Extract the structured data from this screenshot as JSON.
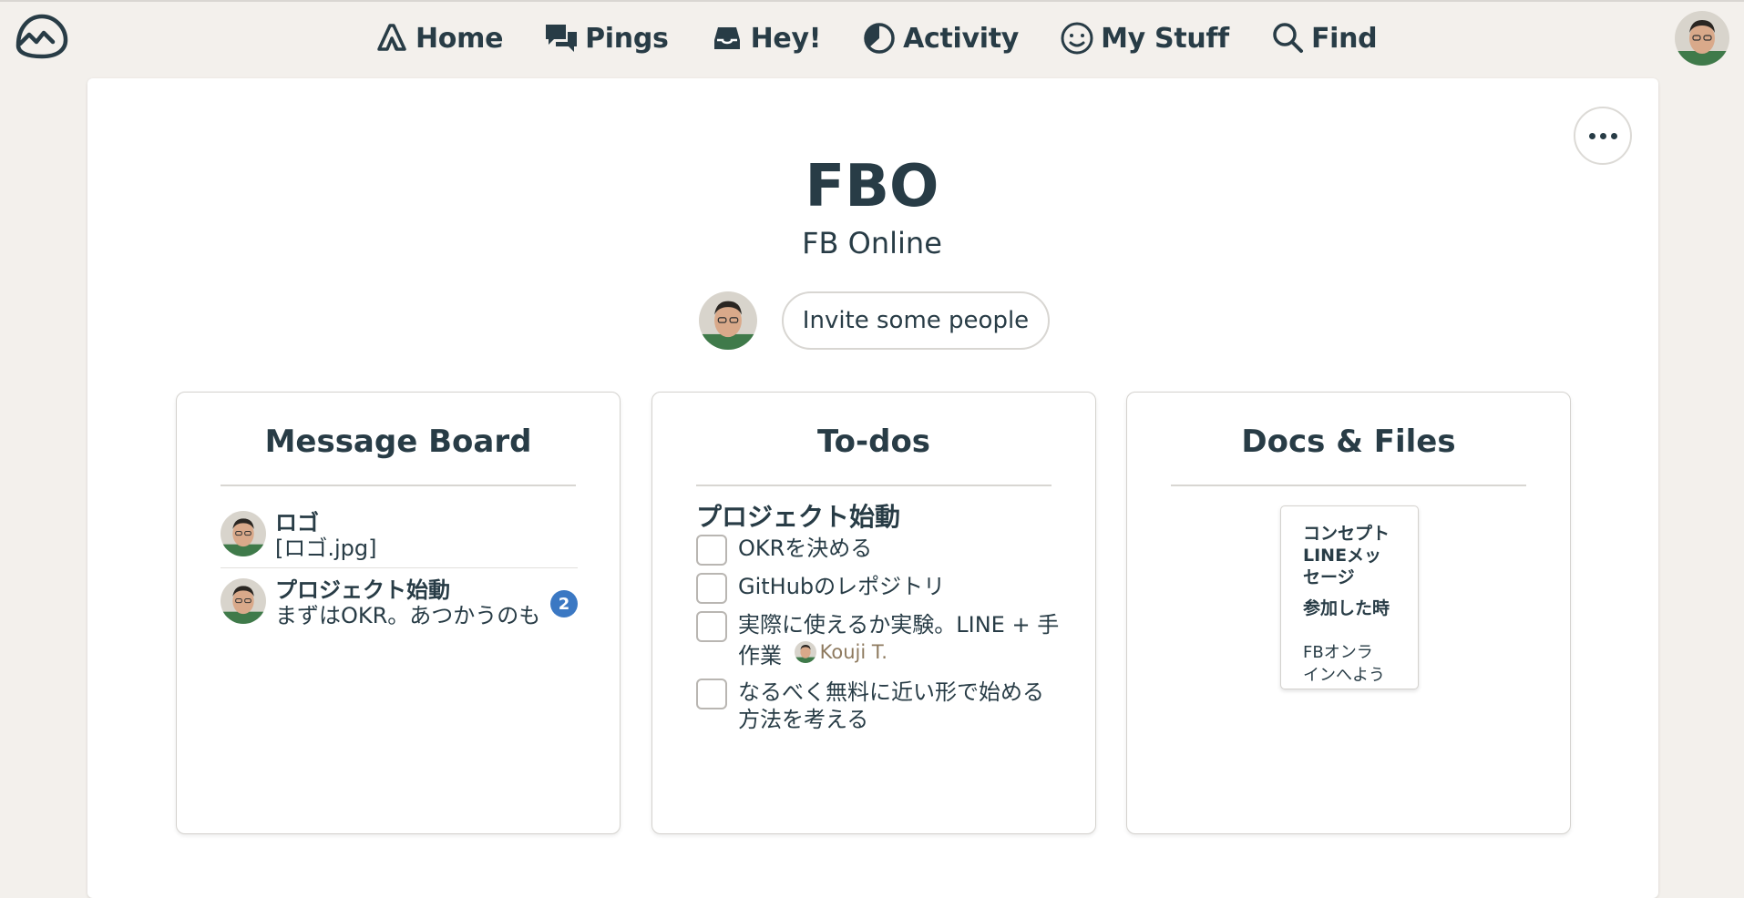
{
  "nav": {
    "items": [
      {
        "label": "Home",
        "icon": "home-icon"
      },
      {
        "label": "Pings",
        "icon": "pings-icon"
      },
      {
        "label": "Hey!",
        "icon": "hey-inbox-icon"
      },
      {
        "label": "Activity",
        "icon": "activity-icon"
      },
      {
        "label": "My Stuff",
        "icon": "my-stuff-icon"
      },
      {
        "label": "Find",
        "icon": "search-icon"
      }
    ]
  },
  "project": {
    "title": "FBO",
    "subtitle": "FB Online",
    "invite_label": "Invite some people"
  },
  "message_board": {
    "title": "Message Board",
    "messages": [
      {
        "title": "ロゴ",
        "excerpt": "[ロゴ.jpg]",
        "badge": ""
      },
      {
        "title": "プロジェクト始動",
        "excerpt": "まずはOKR。あつかうのも",
        "badge": "2"
      }
    ]
  },
  "todos": {
    "title": "To-dos",
    "list_name": "プロジェクト始動",
    "items": [
      {
        "text": "OKRを決める"
      },
      {
        "text": "GitHubのレポジトリ"
      },
      {
        "text_line1": "実際に使えるか実験。LINE + 手",
        "text_line2": "作業",
        "assignee": "Kouji T."
      },
      {
        "text_line1": "なるべく無料に近い形で始める",
        "text_line2": "方法を考える"
      }
    ]
  },
  "docs": {
    "title": "Docs & Files",
    "doc_preview": {
      "line1": "コンセプト",
      "line2": "LINEメッ",
      "line3": "セージ",
      "line4": "参加した時",
      "line5": "FBオンラ",
      "line6": "インへよう"
    }
  },
  "colors": {
    "background": "#f3f0ec",
    "text": "#283c46",
    "badge": "#3b78c3",
    "assignee": "#8e7a5f"
  }
}
